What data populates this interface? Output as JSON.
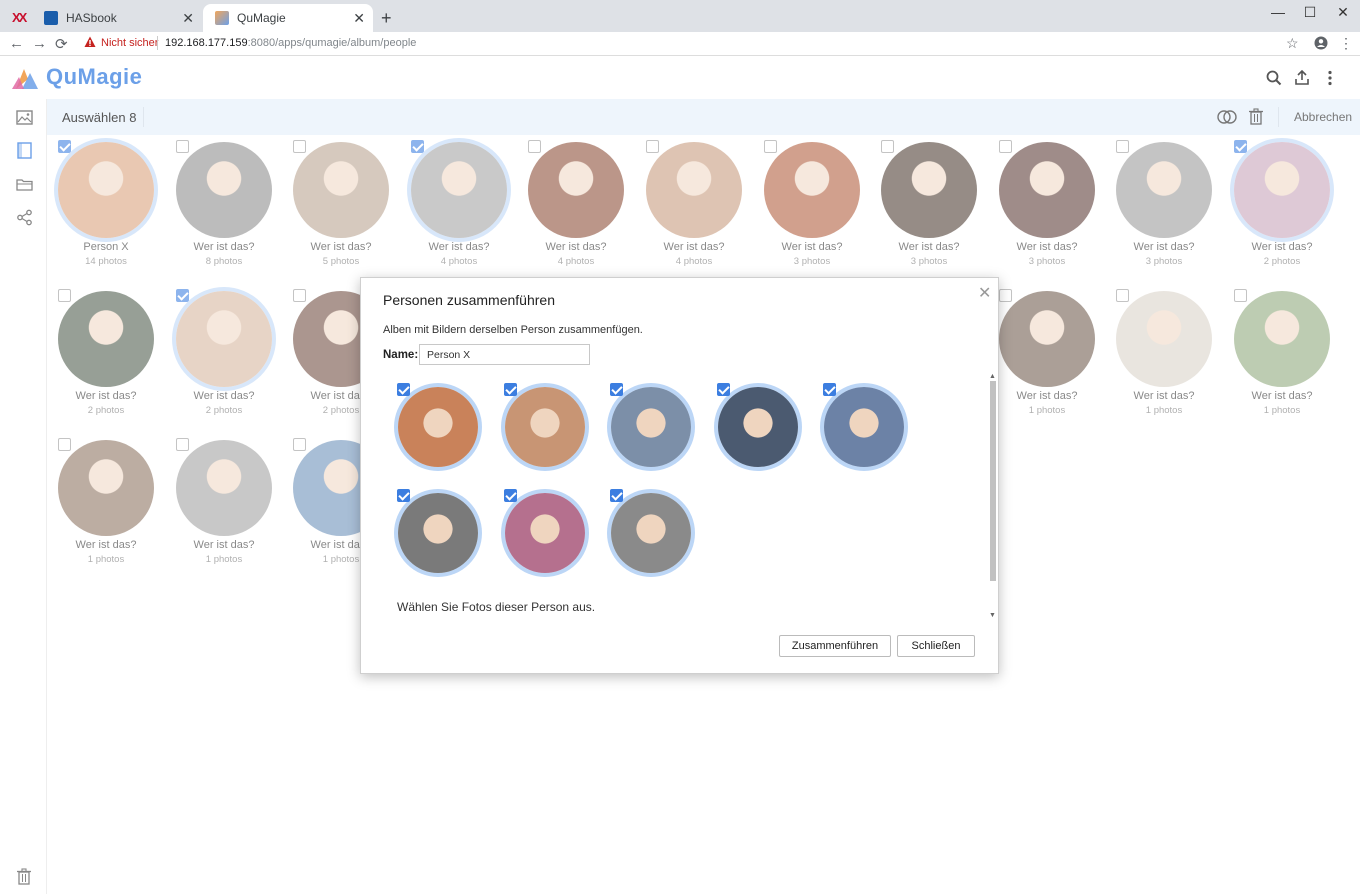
{
  "browser": {
    "tabs": [
      {
        "title": "HASbook",
        "active": false
      },
      {
        "title": "QuMagie",
        "active": true
      }
    ],
    "new_tab": "+",
    "insecure_label": "Nicht sicher",
    "url_host": "192.168.177.159",
    "url_rest": ":8080/apps/qumagie/album/people",
    "window_controls": {
      "minimize": "—",
      "maximize": "☐",
      "close": "✕"
    },
    "brand_logo": "XX",
    "tab_close": "✕",
    "icons": {
      "back": "←",
      "forward": "→",
      "reload": "⟳",
      "bookmark": "☆",
      "menu": "⋮"
    }
  },
  "app": {
    "logo_text": "QuMagie",
    "header_icons": [
      "search-icon",
      "upload-icon",
      "more-vert-icon"
    ]
  },
  "sidebar": {
    "icons": [
      "photos-icon",
      "album-icon",
      "folder-icon",
      "share-icon"
    ],
    "bottom_icon": "trash-icon"
  },
  "actionbar": {
    "selection_label": "Auswählen 8",
    "cancel_label": "Abbrechen",
    "icons": [
      "merge-icon",
      "delete-icon"
    ]
  },
  "people": [
    {
      "name": "Person X",
      "count": "14 photos",
      "checked": true,
      "color": "#d9a17a"
    },
    {
      "name": "Wer ist das?",
      "count": "8 photos",
      "checked": false,
      "color": "#8c8c8c"
    },
    {
      "name": "Wer ist das?",
      "count": "5 photos",
      "checked": false,
      "color": "#b8a28f"
    },
    {
      "name": "Wer ist das?",
      "count": "4 photos",
      "checked": true,
      "color": "#a3a3a3"
    },
    {
      "name": "Wer ist das?",
      "count": "4 photos",
      "checked": false,
      "color": "#8a4b35"
    },
    {
      "name": "Wer ist das?",
      "count": "4 photos",
      "checked": false,
      "color": "#c79a7c"
    },
    {
      "name": "Wer ist das?",
      "count": "3 photos",
      "checked": false,
      "color": "#b05c3c"
    },
    {
      "name": "Wer ist das?",
      "count": "3 photos",
      "checked": false,
      "color": "#4a3a30"
    },
    {
      "name": "Wer ist das?",
      "count": "3 photos",
      "checked": false,
      "color": "#5a3a34"
    },
    {
      "name": "Wer ist das?",
      "count": "3 photos",
      "checked": false,
      "color": "#9a9a9a"
    },
    {
      "name": "Wer ist das?",
      "count": "2 photos",
      "checked": true,
      "color": "#c7a3b8"
    },
    {
      "name": "Wer ist das?",
      "count": "2 photos",
      "checked": false,
      "color": "#4c5a4a"
    },
    {
      "name": "Wer ist das?",
      "count": "2 photos",
      "checked": true,
      "color": "#d6b59d"
    },
    {
      "name": "Wer ist das?",
      "count": "2 photos",
      "checked": false,
      "color": "#6e4a3e"
    },
    {
      "name": "Wer ist das?",
      "count": "1 photos",
      "checked": false,
      "color": "#e0c9b3"
    },
    {
      "name": "Wer ist das?",
      "count": "1 photos",
      "checked": false,
      "color": "#b88b4a"
    },
    {
      "name": "Wer ist das?",
      "count": "1 photos",
      "checked": false,
      "color": "#e8b07a"
    },
    {
      "name": "Wer ist das?",
      "count": "1 photos",
      "checked": false,
      "color": "#c84a3a"
    },
    {
      "name": "Wer ist das?",
      "count": "1 photos",
      "checked": false,
      "color": "#e3c6a1"
    },
    {
      "name": "Wer ist das?",
      "count": "1 photos",
      "checked": false,
      "color": "#6e5a4c"
    },
    {
      "name": "Wer ist das?",
      "count": "1 photos",
      "checked": false,
      "color": "#d9d2c8"
    },
    {
      "name": "Wer ist das?",
      "count": "1 photos",
      "checked": false,
      "color": "#8ea87a"
    },
    {
      "name": "Wer ist das?",
      "count": "1 photos",
      "checked": false,
      "color": "#8c7260"
    },
    {
      "name": "Wer ist das?",
      "count": "1 photos",
      "checked": false,
      "color": "#a0a0a0"
    },
    {
      "name": "Wer ist das?",
      "count": "1 photos",
      "checked": false,
      "color": "#6a8fb8"
    },
    {
      "name": "Wer ist das?",
      "count": "1 photos",
      "checked": false,
      "color": "#e6c49a"
    },
    {
      "name": "Wer ist das?",
      "count": "1 photos",
      "checked": false,
      "color": "#dddddd"
    },
    {
      "name": "Wer ist das?",
      "count": "1 photos",
      "checked": false,
      "color": "#dddddd"
    },
    {
      "name": "Wer ist das?",
      "count": "1 photos",
      "checked": false,
      "color": "#dddddd"
    }
  ],
  "dialog": {
    "title": "Personen zusammenführen",
    "description": "Alben mit Bildern derselben Person zusammenfügen.",
    "name_label": "Name:",
    "name_value": "Person X",
    "faces": [
      {
        "color": "#c9825a"
      },
      {
        "color": "#c89574"
      },
      {
        "color": "#7c8fa8"
      },
      {
        "color": "#4b5a70"
      },
      {
        "color": "#6c82a6"
      },
      {
        "color": "#7a7a7a"
      },
      {
        "color": "#b5708e"
      },
      {
        "color": "#8a8a8a"
      }
    ],
    "hint": "Wählen Sie Fotos dieser Person aus.",
    "merge_button": "Zusammenführen",
    "close_button": "Schließen",
    "close_glyph": "✕"
  },
  "colors": {
    "accent": "#3c7ee0",
    "selection_ring": "#bcd6f6",
    "actionbar_bg": "#eef5fc",
    "logo": "#6ca0e8"
  }
}
